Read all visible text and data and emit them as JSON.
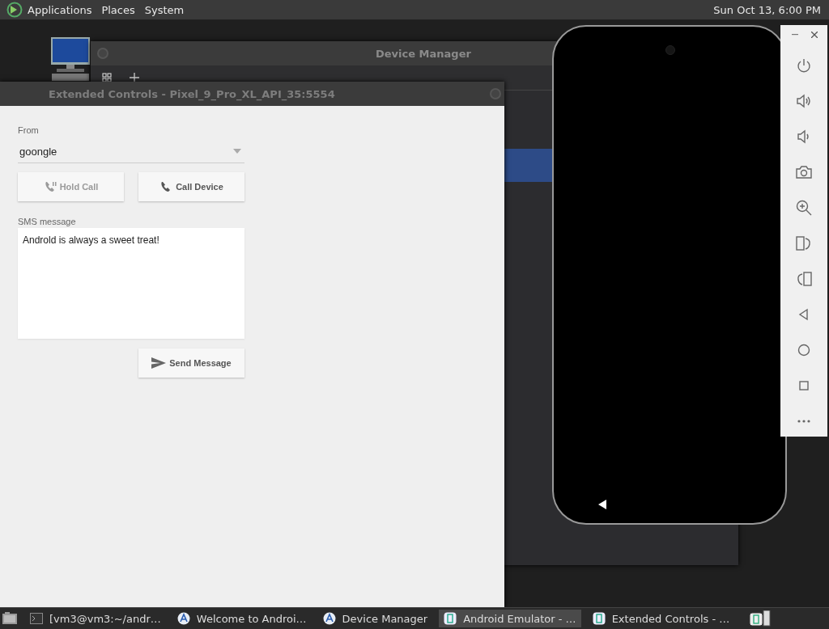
{
  "top_panel": {
    "menus": [
      "Applications",
      "Places",
      "System"
    ],
    "clock": "Sun Oct 13,  6:00 PM"
  },
  "device_manager": {
    "title": "Device Manager",
    "rows": [
      {
        "selected": true
      }
    ]
  },
  "extended_controls": {
    "title": "Extended Controls - Pixel_9_Pro_XL_API_35:5554",
    "from": {
      "label": "From",
      "value": "goongle"
    },
    "call_buttons": [
      {
        "kind": "hold",
        "label": "Hold Call",
        "disabled": true
      },
      {
        "kind": "call",
        "label": "Call Device",
        "disabled": false
      }
    ],
    "sms": {
      "label": "SMS message",
      "value": "Androld is always a sweet treat!"
    },
    "send_button": {
      "label": "Send Message",
      "disabled": false
    }
  },
  "emulator_toolbar": {
    "tools": [
      {
        "kind": "power"
      },
      {
        "kind": "volume-up"
      },
      {
        "kind": "volume-down"
      },
      {
        "kind": "camera"
      },
      {
        "kind": "zoom"
      },
      {
        "kind": "rotate-right"
      },
      {
        "kind": "rotate-left"
      },
      {
        "kind": "back"
      },
      {
        "kind": "home"
      },
      {
        "kind": "overview"
      },
      {
        "kind": "more"
      }
    ]
  },
  "taskbar": {
    "items": [
      {
        "kind": "terminal",
        "label": "[vm3@vm3:~/andr…",
        "selected": false
      },
      {
        "kind": "studio",
        "label": "Welcome to Androi…",
        "selected": false
      },
      {
        "kind": "studio",
        "label": "Device Manager",
        "selected": false
      },
      {
        "kind": "emulator",
        "label": "Android Emulator - …",
        "selected": true
      },
      {
        "kind": "emulator",
        "label": "Extended Controls - …",
        "selected": false
      }
    ]
  }
}
